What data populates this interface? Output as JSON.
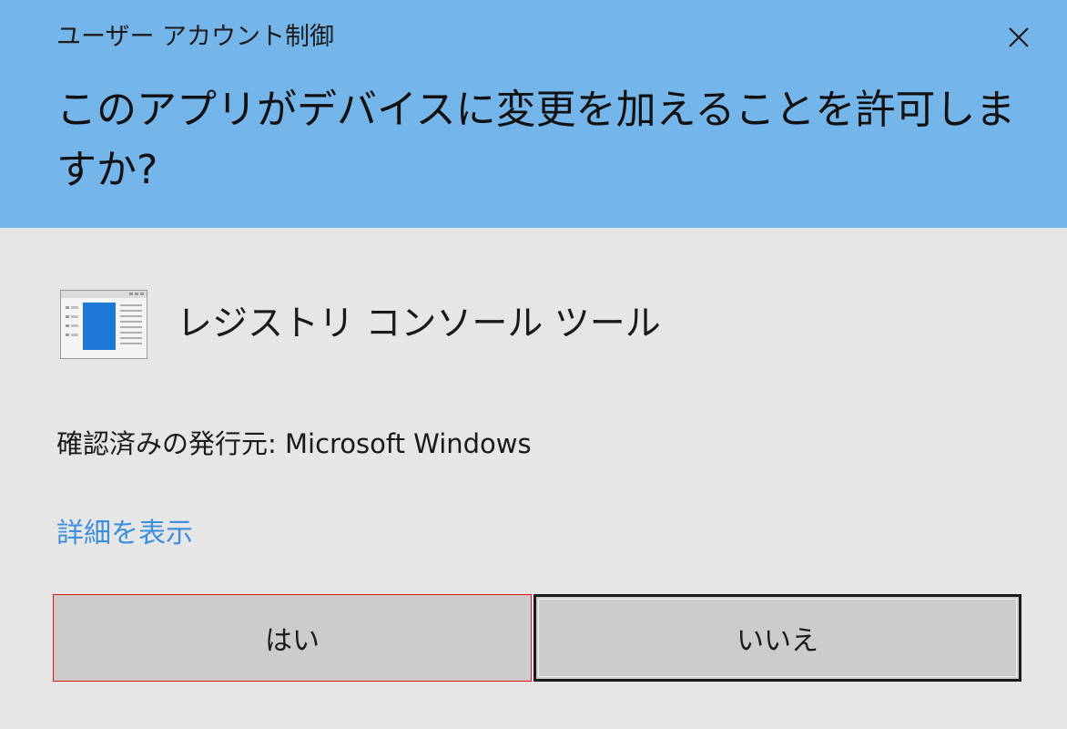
{
  "window": {
    "title": "ユーザー アカウント制御",
    "close_icon": "close-icon"
  },
  "prompt": {
    "question": "このアプリがデバイスに変更を加えることを許可しますか?"
  },
  "app": {
    "icon": "registry-console-app-icon",
    "name": "レジストリ コンソール ツール"
  },
  "publisher": {
    "text": "確認済みの発行元: Microsoft Windows"
  },
  "details": {
    "link_label": "詳細を表示"
  },
  "buttons": {
    "yes_label": "はい",
    "no_label": "いいえ"
  },
  "colors": {
    "header_bg": "#74b5ea",
    "body_bg": "#e6e6e6",
    "link": "#3c8fdc",
    "button_bg": "#cccccc",
    "highlight_border": "#e0141e"
  }
}
